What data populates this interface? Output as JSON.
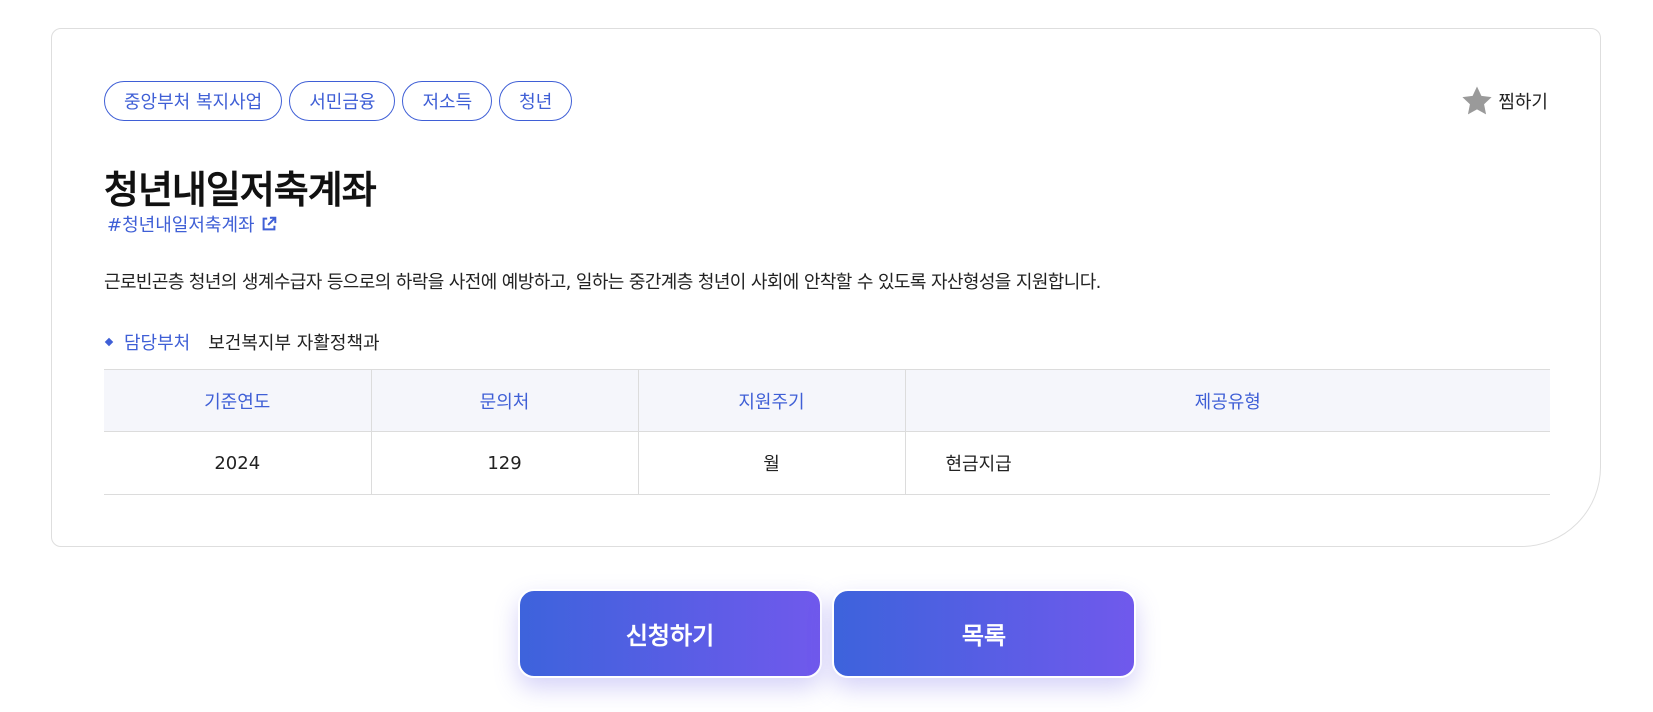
{
  "tags": [
    "중앙부처 복지사업",
    "서민금융",
    "저소득",
    "청년"
  ],
  "bookmark": {
    "label": "찜하기",
    "icon": "star-icon"
  },
  "title": "청년내일저축계좌",
  "hashtag": {
    "label": "#청년내일저축계좌",
    "icon": "external-link-icon"
  },
  "description": "근로빈곤층 청년의 생계수급자 등으로의 하락을 사전에 예방하고, 일하는 중간계층 청년이 사회에 안착할 수 있도록 자산형성을 지원합니다.",
  "department": {
    "label": "담당부처",
    "value": "보건복지부 자활정책과"
  },
  "table": {
    "headers": [
      "기준연도",
      "문의처",
      "지원주기",
      "제공유형"
    ],
    "row": [
      "2024",
      "129",
      "월",
      "현금지급"
    ]
  },
  "buttons": {
    "apply": "신청하기",
    "list": "목록"
  },
  "colors": {
    "accent": "#3f5fd6",
    "gradient_start": "#3d63dc",
    "gradient_end": "#7059ec",
    "header_bg": "#f5f6fb"
  }
}
